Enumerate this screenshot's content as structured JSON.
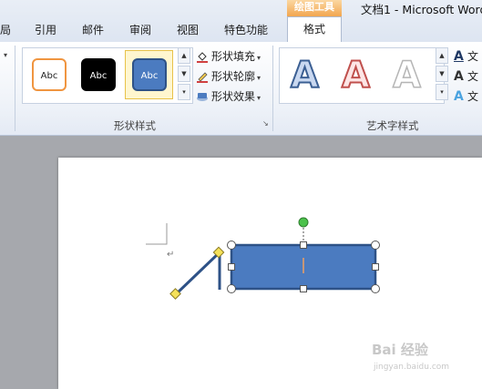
{
  "tabs": [
    {
      "label": "局"
    },
    {
      "label": "引用"
    },
    {
      "label": "邮件"
    },
    {
      "label": "审阅"
    },
    {
      "label": "视图"
    },
    {
      "label": "特色功能"
    }
  ],
  "context_tab": {
    "group_label": "绘图工具",
    "tab_label": "格式"
  },
  "window_title": "文档1 - Microsoft Word",
  "shape_styles": {
    "group_label": "形状样式",
    "presets": [
      {
        "label": "Abc"
      },
      {
        "label": "Abc"
      },
      {
        "label": "Abc"
      }
    ],
    "commands": [
      {
        "label": "形状填充"
      },
      {
        "label": "形状轮廓"
      },
      {
        "label": "形状效果"
      }
    ]
  },
  "wordart_styles": {
    "group_label": "艺术字样式",
    "presets": [
      {
        "label": "A"
      },
      {
        "label": "A"
      },
      {
        "label": "A"
      }
    ],
    "commands": [
      {
        "label": "文"
      },
      {
        "label": "文"
      },
      {
        "label": "文"
      }
    ]
  },
  "paragraph_mark": "↵",
  "watermark": {
    "text": "Bai 经验",
    "sub": "jingyan.baidu.com"
  },
  "colors": {
    "shape_fill": "#4b7bc0",
    "shape_outline": "#2e5287",
    "line": "#2e5287",
    "rotate_handle": "#4cc24c",
    "adjust_handle": "#f5e15a",
    "insertion_cursor": "#f0a060"
  }
}
